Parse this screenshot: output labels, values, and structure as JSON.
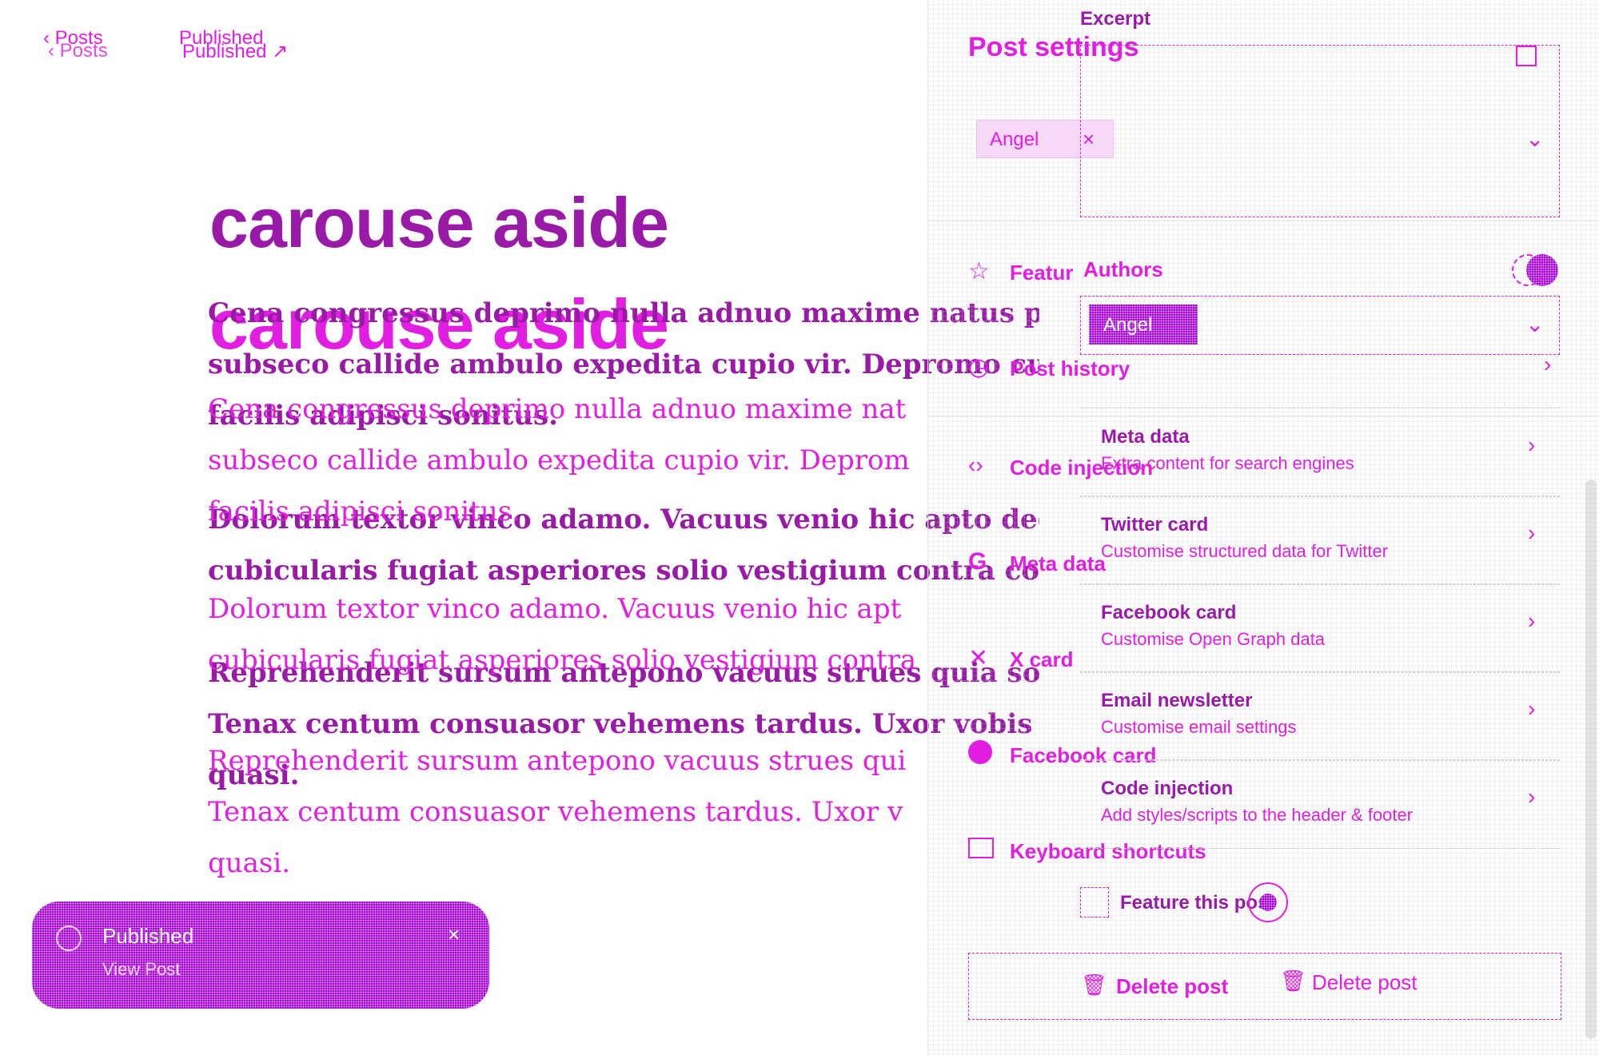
{
  "header": {
    "back_label": "Posts",
    "status_label": "Published",
    "status_link_icon": "external-link-icon"
  },
  "post": {
    "title": "carouse aside",
    "paragraphs": [
      "Cena congressus deprimo nulla adnuo maxime natus porro subseco callide ambulo expedita cupio vir. Depromo cupio facilis adipisci sonitus.",
      "Dolorum textor vinco adamo. Vacuus venio hic apto dedico cubicularis fugiat asperiores solio vestigium contra conque.",
      "Reprehenderit sursum antepono vacuus strues quia socius. Tenax centum consuasor vehemens tardus. Uxor vobis abs quasi."
    ],
    "line_1": "Cena congressus deprimo nulla adnuo maxime natus porro",
    "line_2": "subseco callide ambulo expedita cupio vir. Depromo cupio",
    "line_3": "facilis adipisci sonitus.",
    "line_4": "Dolorum textor vinco adamo. Vacuus venio hic apto dedico",
    "line_5": "cubicularis fugiat asperiores solio vestigium contra conque",
    "line_6": "Reprehenderit sursum antepono vacuus strues quia socius",
    "line_7": "Tenax centum consuasor vehemens tardus. Uxor vobis abs",
    "line_8": "quasi.",
    "ghost_1": "Cena congressus deprimo nulla adnuo maxime nat",
    "ghost_2": "subseco callide ambulo expedita cupio vir. Deprom",
    "ghost_3": "facilis adipisci sonitus.",
    "ghost_4": "Dolorum textor vinco adamo. Vacuus venio hic apt",
    "ghost_5": "cubicularis fugiat asperiores solio vestigium contra",
    "ghost_6": "Reprehenderit sursum antepono vacuus strues qui",
    "ghost_7": "Tenax centum consuasor vehemens tardus. Uxor v",
    "ghost_8": "quasi."
  },
  "toast": {
    "title": "Published",
    "link": "View Post",
    "close": "×"
  },
  "sidebar": {
    "title": "Post settings",
    "author_tag": "Angel",
    "author_tag_remove": "×",
    "feature_label": "Feature this post",
    "feature_label_short": "Featur",
    "author_label": "Authors",
    "post_history": "Post history",
    "code_injection": "Code injection",
    "meta_data": "Meta data",
    "x_card": "X card",
    "facebook_card": "Facebook card",
    "keyboard_shortcuts": "Keyboard shortcuts",
    "delete_post": "Delete post"
  },
  "overlay": {
    "excerpt_label": "Excerpt",
    "selected_author": "Angel",
    "cards": [
      {
        "title": "Meta data",
        "subtitle": "Extra content for search engines"
      },
      {
        "title": "Twitter card",
        "subtitle": "Customise structured data for Twitter"
      },
      {
        "title": "Facebook card",
        "subtitle": "Customise Open Graph data"
      },
      {
        "title": "Email newsletter",
        "subtitle": "Customise email settings"
      },
      {
        "title": "Code injection",
        "subtitle": "Add styles/scripts to the header & footer"
      }
    ],
    "feature_checkbox_label": "Feature this post",
    "delete_label": "Delete post"
  },
  "colors": {
    "accent": "#e11ee1",
    "dark_accent": "#9a1aa8",
    "toast_bg": "#a400d8"
  }
}
